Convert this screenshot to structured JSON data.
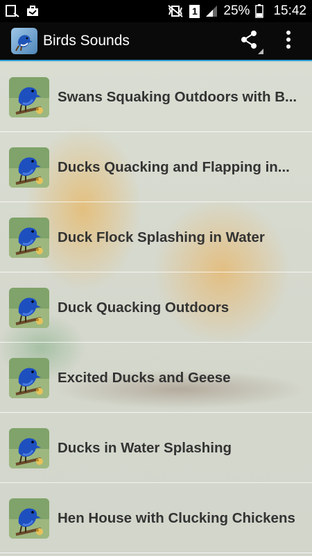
{
  "status": {
    "battery_percent": "25%",
    "time": "15:42",
    "sim_slot": "1"
  },
  "app_bar": {
    "title": "Birds Sounds",
    "share_icon": "share-icon",
    "menu_icon": "more-vert-icon"
  },
  "sounds": [
    {
      "label": "Swans Squaking Outdoors with B..."
    },
    {
      "label": "Ducks Quacking and Flapping in..."
    },
    {
      "label": "Duck Flock Splashing in Water"
    },
    {
      "label": "Duck Quacking Outdoors"
    },
    {
      "label": "Excited Ducks and Geese"
    },
    {
      "label": "Ducks in Water Splashing"
    },
    {
      "label": "Hen House with Clucking Chickens"
    }
  ],
  "colors": {
    "accent": "#2a9fd6",
    "app_bar": "#0a0a0a",
    "label_text": "#333333"
  }
}
